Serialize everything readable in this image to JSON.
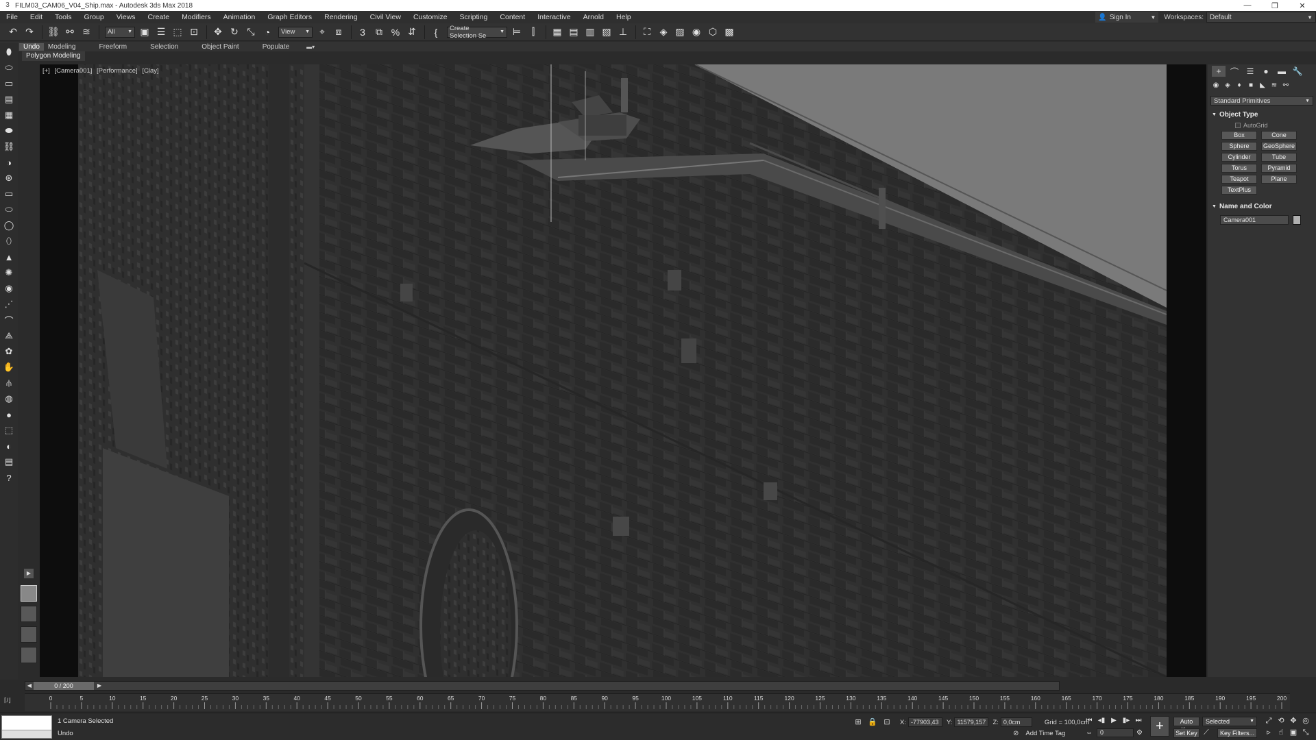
{
  "window": {
    "title": "FILM03_CAM06_V04_Ship.max - Autodesk 3ds Max 2018",
    "app_icon": "3",
    "controls": [
      "—",
      "❐",
      "✕"
    ]
  },
  "menu": [
    "File",
    "Edit",
    "Tools",
    "Group",
    "Views",
    "Create",
    "Modifiers",
    "Animation",
    "Graph Editors",
    "Rendering",
    "Civil View",
    "Customize",
    "Scripting",
    "Content",
    "Interactive",
    "Arnold",
    "Help"
  ],
  "account": {
    "sign_in": "Sign In",
    "workspaces_label": "Workspaces:",
    "workspace": "Default"
  },
  "toolbar": {
    "selection_filter": "All",
    "ref_coord": "View",
    "named_selection": "Create Selection Se",
    "icons": {
      "group1": [
        "↶",
        "↷",
        "⛓",
        "⚯",
        "≋"
      ],
      "group2": [
        "▣",
        "☰",
        "⬚",
        "⊡"
      ],
      "group3": [
        "✥",
        "↻",
        "⤡",
        "◔"
      ],
      "group4": [
        "⌖",
        "⧈",
        "3",
        "⧉",
        "%",
        "⇵",
        "{"
      ],
      "group5": [
        "⊨",
        "⫿",
        "▦",
        "▤",
        "▥",
        "▧",
        "⊥",
        "⛶",
        "◈",
        "▨",
        "◉",
        "⬡",
        "▩"
      ]
    }
  },
  "ribbon": {
    "tabs": [
      "Modeling",
      "Freeform",
      "Selection",
      "Object Paint",
      "Populate"
    ],
    "tooltip": "Undo",
    "sub_tab": "Polygon Modeling"
  },
  "left_command_icons": [
    "⬮",
    "⬭",
    "▭",
    "▤",
    "▦",
    "⬬",
    "⛓",
    "◑",
    "⊛",
    "▭",
    "⬭",
    "◯",
    "⬯",
    "▲",
    "✺",
    "◉",
    "⋰",
    "⌒",
    "⟁",
    "✿",
    "✋",
    "⫛",
    "◍",
    "●",
    "⬚",
    "◐",
    "▤",
    "?"
  ],
  "viewport": {
    "labels": [
      "[+]",
      "[Camera001]",
      "[Performance]",
      "[Clay]"
    ]
  },
  "layout_tabs": {
    "expand": "▶",
    "count": 4
  },
  "command_panel": {
    "tabs": [
      "+",
      "⌒",
      "☰",
      "●",
      "▬",
      "🔧"
    ],
    "categories": [
      "◉",
      "◈",
      "♦",
      "■",
      "◣",
      "≋",
      "⚯"
    ],
    "dropdown": "Standard Primitives",
    "object_type_label": "Object Type",
    "autogrid_label": "AutoGrid",
    "primitives": [
      "Box",
      "Cone",
      "Sphere",
      "GeoSphere",
      "Cylinder",
      "Tube",
      "Torus",
      "Pyramid",
      "Teapot",
      "Plane",
      "TextPlus"
    ],
    "name_and_color_label": "Name and Color",
    "object_name": "Camera001",
    "object_color": "#b0b0b0"
  },
  "timeline": {
    "frame_counter": "0 / 200",
    "frame_range": [
      0,
      200
    ],
    "tick_step": 5,
    "label_step": 5,
    "trackbar_icon": "⌈/⌋"
  },
  "status": {
    "selection": "1 Camera Selected",
    "prompt": "Undo",
    "x_label": "X:",
    "x": "-77903,43",
    "y_label": "Y:",
    "y": "11579,157",
    "z_label": "Z:",
    "z": "0,0cm",
    "grid": "Grid = 100,0cm",
    "add_time_tag": "Add Time Tag",
    "current_frame": "0",
    "auto_key": "Auto Key",
    "set_key": "Set Key",
    "key_mode": "Selected",
    "key_filters": "Key Filters...",
    "playback_icons": [
      "⏮",
      "◂▮",
      "▶",
      "▮▸",
      "⏭"
    ],
    "nav_icons": [
      "⤢",
      "⟲",
      "✥",
      "◎",
      "▹",
      "☝",
      "▣",
      "⤡"
    ],
    "coord_icons": [
      "⊞",
      "🔒",
      "⊡"
    ]
  }
}
